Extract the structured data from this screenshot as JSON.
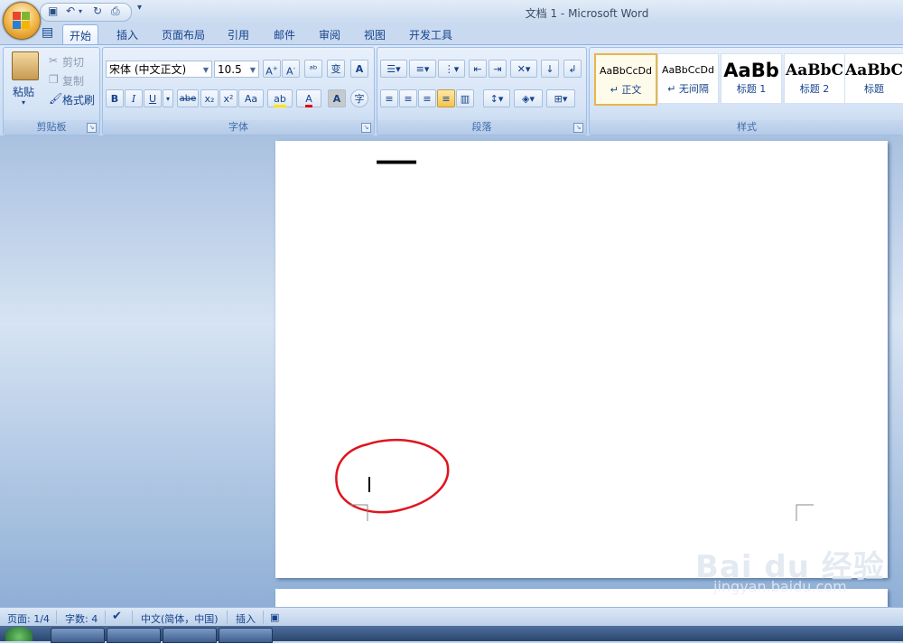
{
  "window": {
    "title": "文档 1 - Microsoft Word"
  },
  "qat": {
    "more": "▾"
  },
  "tabs": [
    "开始",
    "插入",
    "页面布局",
    "引用",
    "邮件",
    "审阅",
    "视图",
    "开发工具"
  ],
  "clipboard": {
    "paste": "粘贴",
    "cut": "剪切",
    "copy": "复制",
    "format_painter": "格式刷",
    "group_label": "剪贴板"
  },
  "font": {
    "name": "宋体 (中文正文)",
    "size": "10.5",
    "group_label": "字体",
    "bold": "B",
    "italic": "I",
    "underline": "U",
    "strike": "abe",
    "sub": "x₂",
    "sup": "x²",
    "case": "Aa"
  },
  "paragraph": {
    "group_label": "段落"
  },
  "styles": {
    "group_label": "样式",
    "items": [
      {
        "sample": "AaBbCcDd",
        "name": "↵ 正文"
      },
      {
        "sample": "AaBbCcDd",
        "name": "↵ 无间隔"
      },
      {
        "sample": "AaBb",
        "name": "标题 1"
      },
      {
        "sample": "AaBbC",
        "name": "标题 2"
      },
      {
        "sample": "AaBbC",
        "name": "标题"
      }
    ]
  },
  "document": {
    "text": "一"
  },
  "status": {
    "page": "页面: 1/4",
    "words": "字数: 4",
    "language": "中文(简体，中国)",
    "mode": "插入"
  },
  "watermark": {
    "brand": "Bai du 经验",
    "url": "jingyan.baidu.com"
  }
}
